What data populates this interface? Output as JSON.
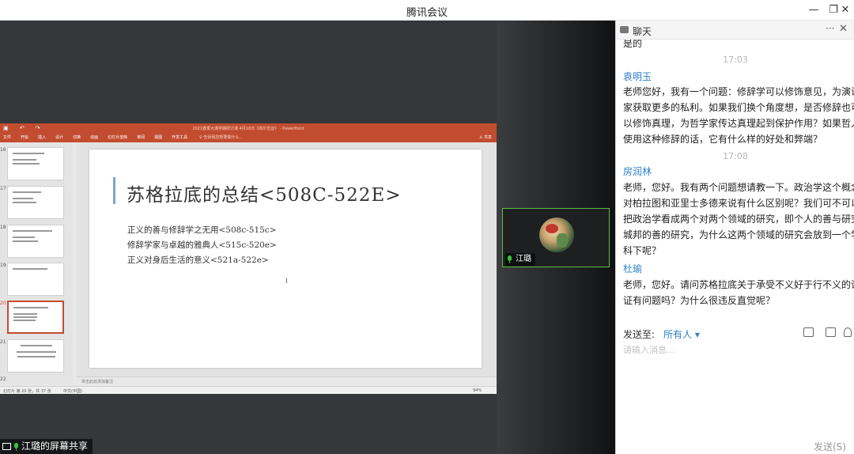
{
  "window": {
    "title": "腾讯会议",
    "minimize": "—",
    "restore": "❐",
    "close": "✕"
  },
  "ppt": {
    "window_title": "2021春季大课学期研讨课 4月18日《高尔吉亚》 - PowerPoint",
    "quick_access": "▣ ↶ ↷",
    "menu": [
      "文件",
      "开始",
      "插入",
      "设计",
      "切换",
      "动画",
      "幻灯片放映",
      "审阅",
      "视图",
      "开发工具"
    ],
    "tell_me": "♀ 告诉我您想要做什么...",
    "share": "♙ 共享",
    "thumb_numbers": [
      "16",
      "17",
      "18",
      "19",
      "20",
      "21",
      "22"
    ],
    "slide": {
      "title": "苏格拉底的总结<508C-522E>",
      "lines": [
        "正义的善与修辞学之无用<508c-515c>",
        "修辞学家与卓越的雅典人<515c-520e>",
        "正义对身后生活的意义<521a-522e>"
      ],
      "cursor": "I"
    },
    "notes_placeholder": "单击此处添加备注",
    "status": {
      "slide_count": "幻灯片 第 20 张，共 37 张",
      "lang": "中文(中国)",
      "zoom": "94%"
    }
  },
  "participant": {
    "name": "江璐",
    "highlight_color": "#5cbf3e"
  },
  "share_label": "江璐的屏幕共享",
  "chat": {
    "title": "聊天",
    "more": "···",
    "close": "✕",
    "messages": [
      {
        "type": "text",
        "text": "是的"
      },
      {
        "type": "time",
        "text": "17:03"
      },
      {
        "type": "name",
        "text": "袁明玉"
      },
      {
        "type": "text",
        "text": "老师您好，我有一个问题：修辞学可以修饰意见，为演说"
      },
      {
        "type": "text",
        "text": "家获取更多的私利。如果我们换个角度想，是否修辞也可"
      },
      {
        "type": "text",
        "text": "以修饰真理，为哲学家传达真理起到保护作用？如果哲人"
      },
      {
        "type": "text",
        "text": "使用这种修辞的话，它有什么样的好处和弊端？"
      },
      {
        "type": "time",
        "text": "17:08"
      },
      {
        "type": "name",
        "text": "房润林"
      },
      {
        "type": "text",
        "text": "老师，您好。我有两个问题想请教一下。政治学这个概念"
      },
      {
        "type": "text",
        "text": "对柏拉图和亚里士多德来说有什么区别呢？我们可不可以"
      },
      {
        "type": "text",
        "text": "把政治学看成两个对两个领域的研究，即个人的善与研究"
      },
      {
        "type": "text",
        "text": "城邦的善的研究，为什么这两个领域的研究会放到一个学"
      },
      {
        "type": "text",
        "text": "科下呢？"
      },
      {
        "type": "name",
        "text": "杜瑜"
      },
      {
        "type": "text",
        "text": "老师，您好。请问苏格拉底关于承受不义好于行不义的论"
      },
      {
        "type": "text",
        "text": "证有问题吗？为什么很违反直觉呢？"
      }
    ],
    "send_to_label": "发送至:",
    "send_target": "所有人 ▾",
    "input_placeholder": "请输入消息...",
    "send_button": "发送(S)",
    "name_color": "#2e7fc9"
  }
}
